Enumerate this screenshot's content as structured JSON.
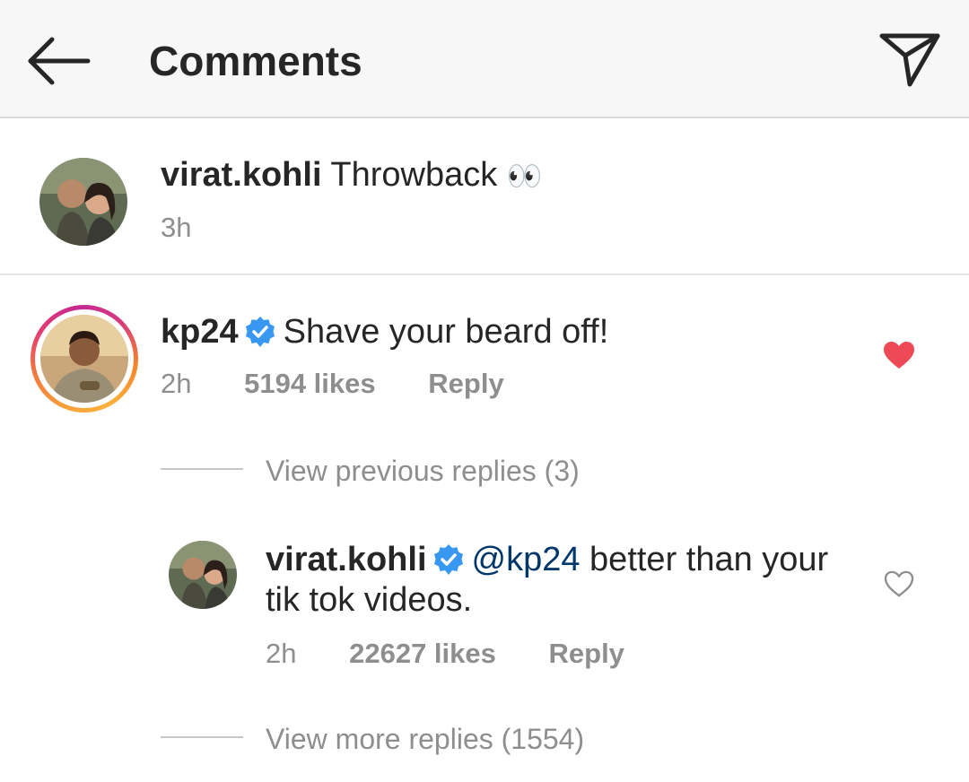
{
  "header": {
    "title": "Comments",
    "back_icon": "arrow-left-icon",
    "share_icon": "paper-plane-icon"
  },
  "caption": {
    "username": "virat.kohli",
    "text": "Throwback",
    "emoji": "👀",
    "time": "3h"
  },
  "comment": {
    "username": "kp24",
    "verified": true,
    "text": "Shave your beard off!",
    "time": "2h",
    "likes": "5194 likes",
    "reply_label": "Reply",
    "liked": true,
    "heart_color": "#ed4956"
  },
  "view_previous": "View previous replies (3)",
  "reply": {
    "username": "virat.kohli",
    "verified": true,
    "mention": "@kp24",
    "text_line1": "better than your",
    "text_line2": "tik tok videos.",
    "time": "2h",
    "likes": "22627 likes",
    "reply_label": "Reply",
    "liked": false
  },
  "view_more": "View more replies (1554)",
  "colors": {
    "verified": "#3897f0",
    "mention": "#00376b",
    "meta": "#8e8e8e"
  }
}
